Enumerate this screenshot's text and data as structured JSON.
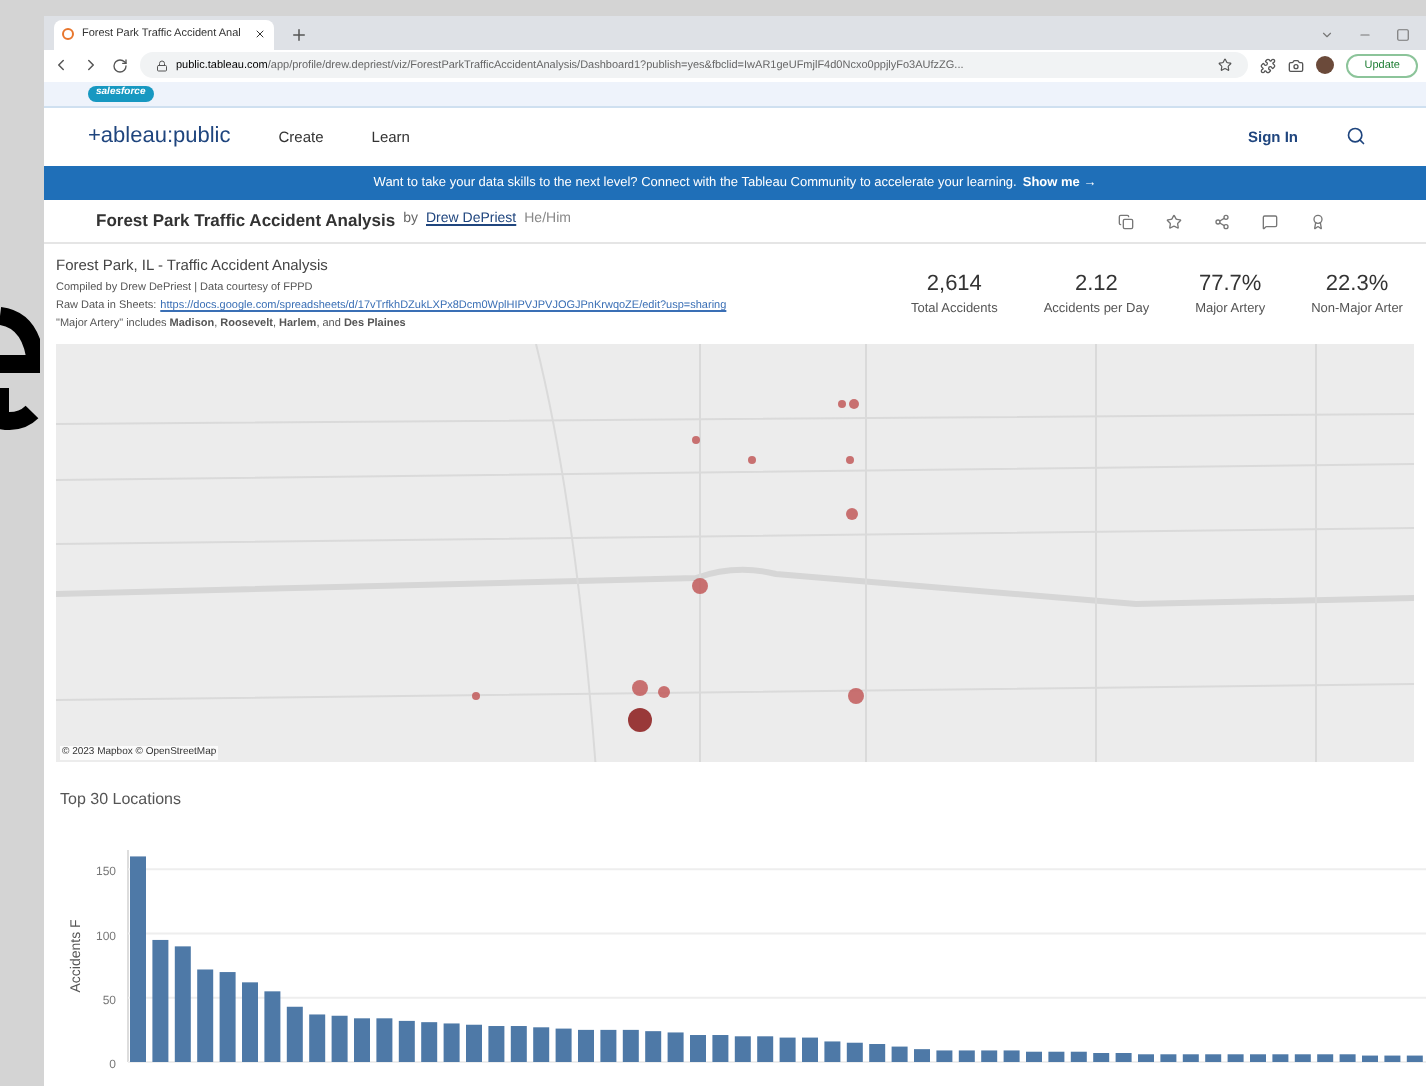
{
  "browser": {
    "tab_title": "Forest Park Traffic Accident Anal",
    "url_host": "public.tableau.com",
    "url_path": "/app/profile/drew.depriest/viz/ForestParkTrafficAccidentAnalysis/Dashboard1?publish=yes&fbclid=IwAR1geUFmjlF4d0Ncxo0ppjlyFo3AUfzZG...",
    "update_label": "Update"
  },
  "salesforce_label": "salesforce",
  "nav": {
    "logo": "+ableau:public",
    "items": [
      "Create",
      "Learn"
    ],
    "sign_in": "Sign In"
  },
  "banner": {
    "text": "Want to take your data skills to the next level? Connect with the Tableau Community to accelerate your learning.",
    "link": "Show me →"
  },
  "viz": {
    "title": "Forest Park Traffic Accident Analysis",
    "by": "by",
    "author": "Drew DePriest",
    "pronouns": "He/Him"
  },
  "dashboard": {
    "heading": "Forest Park, IL - Traffic Accident Analysis",
    "compiled": "Compiled by Drew DePriest | Data courtesy of FPPD",
    "raw_label": "Raw Data in Sheets:",
    "raw_link": "https://docs.google.com/spreadsheets/d/17vTrfkhDZukLXPx8Dcm0WplHIPVJPVJOGJPnKrwqoZE/edit?usp=sharing",
    "note": "\"Major Artery\" includes **Madison**, **Roosevelt**, **Harlem**, and **Des Plaines**",
    "kpis": [
      {
        "value": "2,614",
        "label": "Total Accidents"
      },
      {
        "value": "2.12",
        "label": "Accidents per Day"
      },
      {
        "value": "77.7%",
        "label": "Major Artery"
      },
      {
        "value": "22.3%",
        "label": "Non-Major Arter"
      }
    ]
  },
  "map": {
    "attribution": "© 2023 Mapbox © OpenStreetMap"
  },
  "locations_chart": {
    "title": "Top 30 Locations",
    "chart_data": {
      "type": "bar",
      "ylabel": "Accidents F",
      "yticks": [
        0,
        50,
        100,
        150
      ],
      "ylim": [
        0,
        165
      ],
      "grid": true,
      "values": [
        160,
        95,
        90,
        72,
        70,
        62,
        55,
        43,
        37,
        36,
        34,
        34,
        32,
        31,
        30,
        29,
        28,
        28,
        27,
        26,
        25,
        25,
        25,
        24,
        23,
        21,
        21,
        20,
        20,
        19,
        19,
        16,
        15,
        14,
        12,
        10,
        9,
        9,
        9,
        9,
        8,
        8,
        8,
        7,
        7,
        6,
        6,
        6,
        6,
        6,
        6,
        6,
        6,
        6,
        6,
        5,
        5,
        5
      ]
    }
  }
}
